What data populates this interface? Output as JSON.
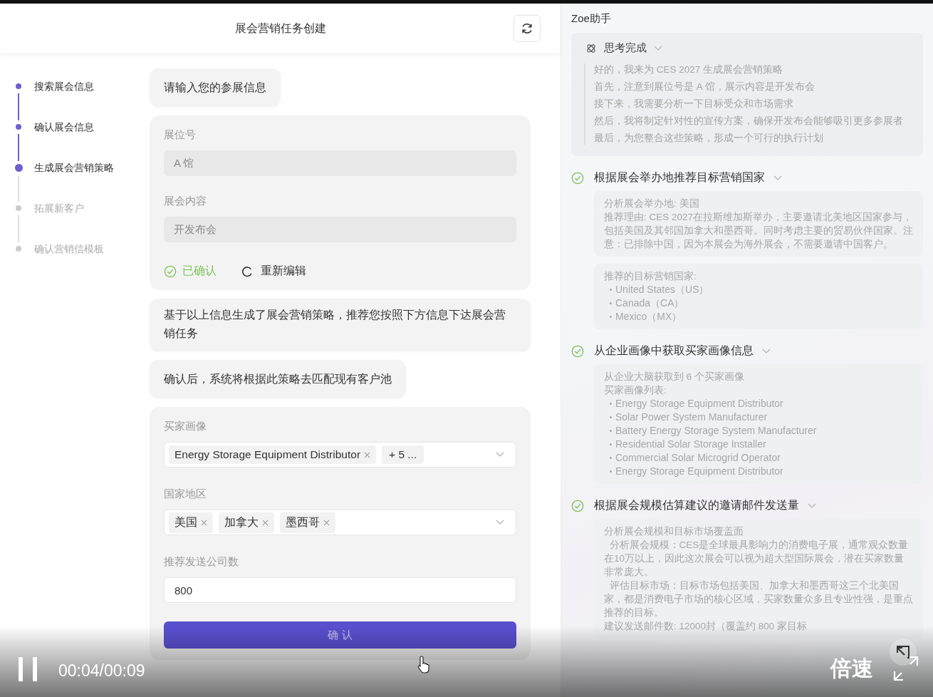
{
  "task_panel": {
    "title": "展会营销任务创建",
    "steps": [
      {
        "label": "搜索展会信息",
        "done": true,
        "selected": false
      },
      {
        "label": "确认展会信息",
        "done": true,
        "selected": false
      },
      {
        "label": "生成展会营销策略",
        "done": false,
        "selected": true
      },
      {
        "label": "拓展新客户",
        "done": false,
        "selected": false
      },
      {
        "label": "确认营销信模板",
        "done": false,
        "selected": false
      }
    ],
    "intro_message": "请输入您的参展信息",
    "booth_form": {
      "fields": [
        {
          "label": "展位号",
          "value": "A 馆",
          "disabled": true
        },
        {
          "label": "展会内容",
          "value": "开发布会",
          "disabled": true
        }
      ],
      "confirmed_label": "已确认",
      "reedit_label": "重新编辑"
    },
    "messages": [
      "基于以上信息生成了展会营销策略，推荐您按照下方信息下达展会营销任务",
      "确认后，系统将根据此策略去匹配现有客户池"
    ],
    "task_form": {
      "fields": [
        {
          "kind": "tags",
          "label": "买家画像",
          "tags": [
            "Energy Storage Equipment Distributor"
          ],
          "more": "+ 5 ..."
        },
        {
          "kind": "tags",
          "label": "国家地区",
          "tags": [
            "美国",
            "加拿大",
            "墨西哥"
          ]
        },
        {
          "kind": "input",
          "label": "推荐发送公司数",
          "value": "800"
        }
      ],
      "submit_label": "确 认"
    }
  },
  "assistant": {
    "title": "Zoe助手",
    "thinking": {
      "label": "思考完成",
      "expanded": true,
      "lines": [
        "好的，我来为 CES 2027 生成展会营销策略",
        "首先，注意到展位号是 A 馆，展示内容是开发布会",
        "接下来，我需要分析一下目标受众和市场需求",
        "然后，我将制定针对性的宣传方案，确保开发布会能够吸引更多参展者",
        "最后，为您整合这些策略，形成一个可行的执行计划"
      ]
    },
    "steps": [
      {
        "title": "根据展会举办地推荐目标营销国家",
        "done": true,
        "expanded": true,
        "blocks": [
          {
            "lines": [
              "分析展会举办地: 美国",
              "推荐理由: CES 2027在拉斯维加斯举办，主要邀请北美地区国家参与，包括美国及其邻国加拿大和墨西哥。同时考虑主要的贸易伙伴国家。注意：已排除中国，因为本展会为海外展会，不需要邀请中国客户。"
            ]
          },
          {
            "lines": [
              "推荐的目标营销国家:"
            ],
            "bullets": [
              "United States（US）",
              "Canada（CA）",
              "Mexico（MX）"
            ]
          }
        ]
      },
      {
        "title": "从企业画像中获取买家画像信息",
        "done": true,
        "expanded": true,
        "blocks": [
          {
            "lines": [
              "从企业大脑获取到 6 个买家画像",
              "买家画像列表:"
            ],
            "bullets": [
              "Energy Storage Equipment Distributor",
              "Solar Power System Manufacturer",
              "Battery Energy Storage System Manufacturer",
              "Residential Solar Storage Installer",
              "Commercial Solar Microgrid Operator",
              "Energy Storage Equipment Distributor"
            ]
          }
        ]
      },
      {
        "title": "根据展会规模估算建议的邀请邮件发送量",
        "done": true,
        "expanded": true,
        "blocks": [
          {
            "lines": [
              "分析展会规模和目标市场覆盖面",
              "  分析展会规模：CES是全球最具影响力的消费电子展，通常观众数量在10万以上，因此这次展会可以视为超大型国际展会，潜在买家数量非常庞大。",
              "  评估目标市场：目标市场包括美国、加拿大和墨西哥这三个北美国家，都是消费电子市场的核心区域，买家数量众多且专业性强，是重点推荐的目标。",
              "建议发送邮件数: 12000封（覆盖约 800 家目标"
            ]
          }
        ]
      }
    ]
  },
  "video_player": {
    "playing": true,
    "time": "00:04/00:09",
    "speed_label": "倍速"
  }
}
